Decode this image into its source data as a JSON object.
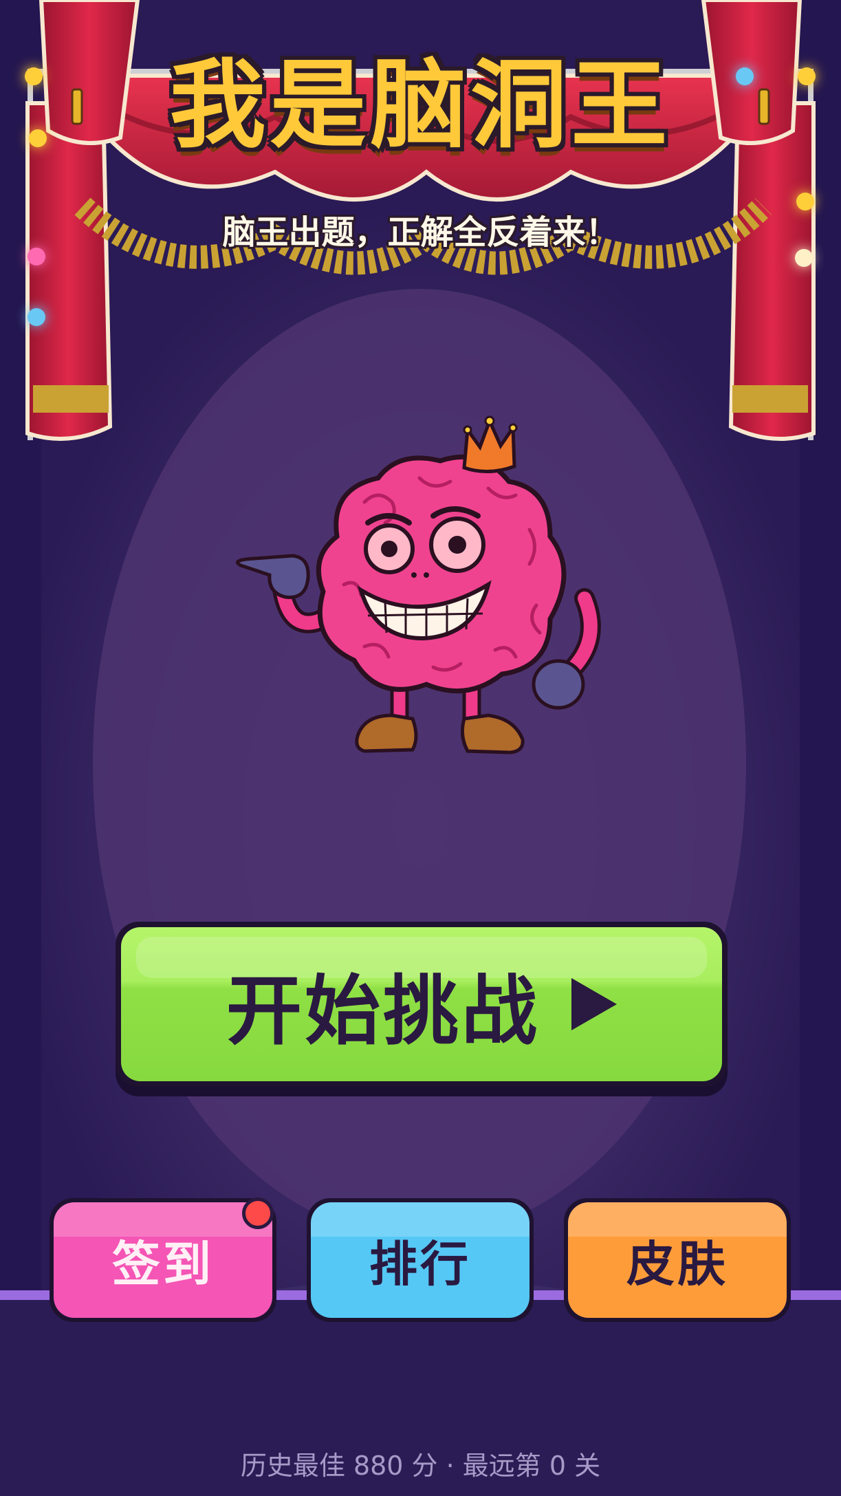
{
  "app": {
    "title": "我是脑洞王",
    "subtitle": "脑王出题，正解全反着来！"
  },
  "actions": {
    "start_label": "开始挑战",
    "checkin_label": "签到",
    "rank_label": "排行",
    "skin_label": "皮肤",
    "checkin_has_notification": true
  },
  "footer": {
    "stats_text": "历史最佳 880 分 · 最远第 0 关"
  },
  "icons": {
    "play": "play-icon",
    "mascot": "brain-king-mascot"
  },
  "colors": {
    "background": "#3f2c6a",
    "title": "#ffc93a",
    "start_button": "#8fe045",
    "checkin_button": "#f555b5",
    "rank_button": "#55c8f5",
    "skin_button": "#ff9c3a",
    "curtain": "#d8203f",
    "notification_dot": "#ff4a4a"
  }
}
